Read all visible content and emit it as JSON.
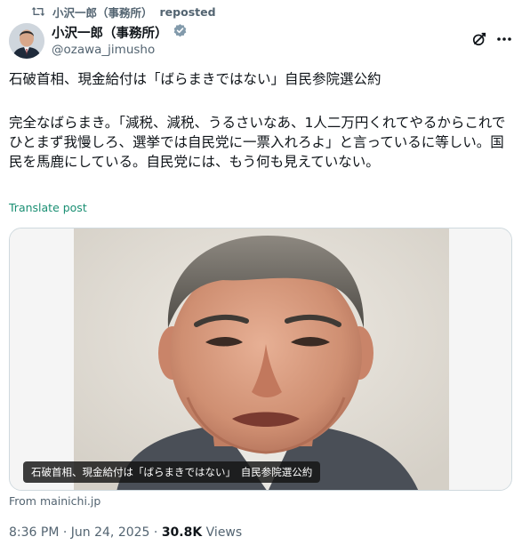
{
  "repost": {
    "icon": "repost-icon",
    "user": "小沢一郎（事務所）",
    "label": "reposted"
  },
  "author": {
    "display_name": "小沢一郎（事務所）",
    "handle": "@ozawa_jimusho",
    "verified_icon": "verified-badge-icon",
    "verified_color": "#829aab"
  },
  "actions": {
    "grok_icon": "grok-icon",
    "more_icon": "more-icon"
  },
  "post": {
    "title": "石破首相、現金給付は「ばらまきではない」自民参院選公約",
    "body": "完全なばらまき。「減税、減税、うるさいなあ、1人二万円くれてやるからこれでひとまず我慢しろ、選挙では自民党に一票入れろよ」と言っているに等しい。国民を馬鹿にしている。自民党には、もう何も見えていない。",
    "translate": "Translate post"
  },
  "media": {
    "caption": "石破首相、現金給付は「ばらまきではない」　自民参院選公約",
    "source": "From mainichi.jp"
  },
  "meta": {
    "time": "8:36 PM",
    "sep1": " · ",
    "date": "Jun 24, 2025",
    "sep2": " · ",
    "views_count": "30.8K",
    "views_label": " Views"
  },
  "colors": {
    "text": "#0f1419",
    "secondary": "#536471",
    "translate": "#1a8f73",
    "border": "#cfd9de"
  }
}
